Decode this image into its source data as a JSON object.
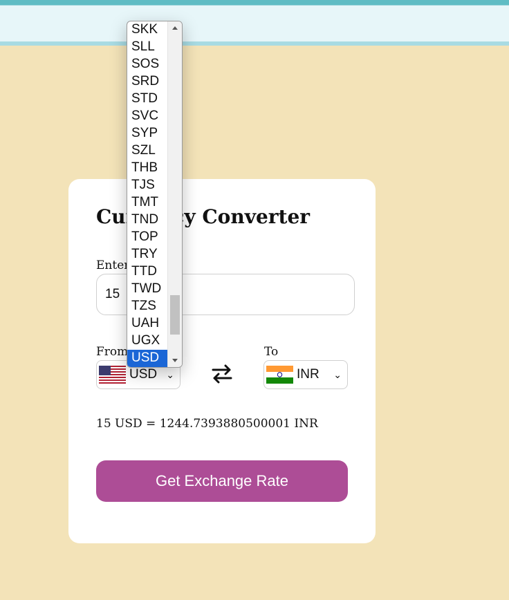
{
  "card": {
    "title": "Currency Converter",
    "amount_label": "Enter Amount",
    "amount_value": "15",
    "from_label": "From",
    "to_label": "To",
    "result_text": "15 USD = 1244.7393880500001 INR",
    "button_label": "Get Exchange Rate"
  },
  "from_select": {
    "value": "USD",
    "flag": "us-flag-icon"
  },
  "to_select": {
    "value": "INR",
    "flag": "india-flag-icon"
  },
  "dropdown": {
    "options": [
      "SKK",
      "SLL",
      "SOS",
      "SRD",
      "STD",
      "SVC",
      "SYP",
      "SZL",
      "THB",
      "TJS",
      "TMT",
      "TND",
      "TOP",
      "TRY",
      "TTD",
      "TWD",
      "TZS",
      "UAH",
      "UGX",
      "USD"
    ],
    "selected": "USD"
  },
  "colors": {
    "background": "#f3e3b8",
    "button": "#ad4d96",
    "selected_option": "#1a66d6"
  }
}
